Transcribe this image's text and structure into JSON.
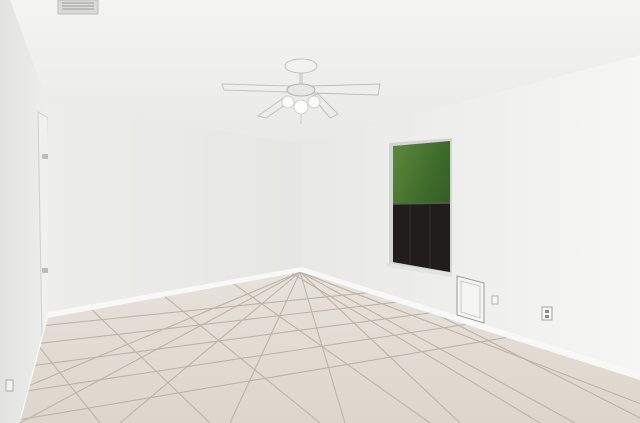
{
  "scene": {
    "description_tag": "empty-room-photo",
    "watermark_text": "",
    "colors": {
      "ceiling": "#f2f2f0",
      "wall_left": "#ececea",
      "wall_back": "#f0f0ee",
      "wall_right": "#f3f3f1",
      "floor": "#e4ded6",
      "grout": "#b9b1a6",
      "baseboard": "#f7f7f5",
      "window_frame": "#d8d8d6",
      "foliage": "#3f6b2e",
      "window_dark": "#1d1c1b"
    },
    "objects": [
      "ceiling-fan",
      "window",
      "door",
      "floor-vent",
      "wall-outlet",
      "ceiling-vent"
    ]
  }
}
